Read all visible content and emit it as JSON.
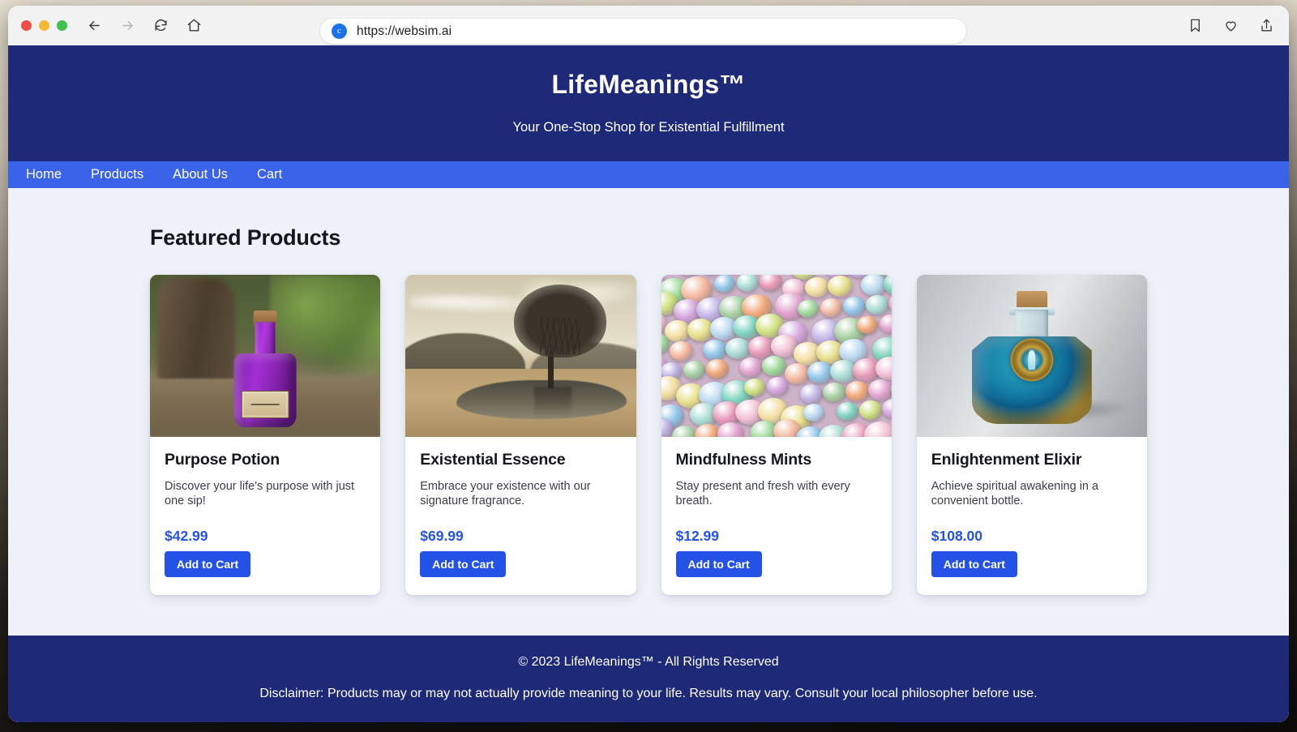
{
  "browser": {
    "url": "https://websim.ai",
    "favicon_letter": "c",
    "icons": {
      "back": "back-arrow-icon",
      "forward": "forward-arrow-icon",
      "reload": "reload-icon",
      "home": "home-icon",
      "bookmark": "bookmark-icon",
      "favorite": "heart-icon",
      "share": "share-icon"
    }
  },
  "site": {
    "title": "LifeMeanings™",
    "tagline": "Your One-Stop Shop for Existential Fulfillment",
    "header_bg": "#1e2a78",
    "nav_bg": "#3b63ea",
    "accent": "#2552e6",
    "page_bg": "#eef1f8"
  },
  "nav": {
    "items": [
      {
        "label": "Home"
      },
      {
        "label": "Products"
      },
      {
        "label": "About Us"
      },
      {
        "label": "Cart"
      }
    ]
  },
  "main": {
    "section_title": "Featured Products",
    "products": [
      {
        "name": "Purpose Potion",
        "description": "Discover your life's purpose with just one sip!",
        "price": "$42.99",
        "button_label": "Add to Cart",
        "image_alt": "purple-potion-bottle-in-forest"
      },
      {
        "name": "Existential Essence",
        "description": "Embrace your existence with our signature fragrance.",
        "price": "$69.99",
        "button_label": "Add to Cart",
        "image_alt": "lone-tree-beside-pond-sepia-landscape"
      },
      {
        "name": "Mindfulness Mints",
        "description": "Stay present and fresh with every breath.",
        "price": "$12.99",
        "button_label": "Add to Cart",
        "image_alt": "pile-of-pastel-colored-mints"
      },
      {
        "name": "Enlightenment Elixir",
        "description": "Achieve spiritual awakening in a convenient bottle.",
        "price": "$108.00",
        "button_label": "Add to Cart",
        "image_alt": "teal-elixir-bottle-with-gold-emblem"
      }
    ]
  },
  "footer": {
    "copyright": "© 2023 LifeMeanings™ - All Rights Reserved",
    "disclaimer": "Disclaimer: Products may or may not actually provide meaning to your life. Results may vary. Consult your local philosopher before use."
  }
}
